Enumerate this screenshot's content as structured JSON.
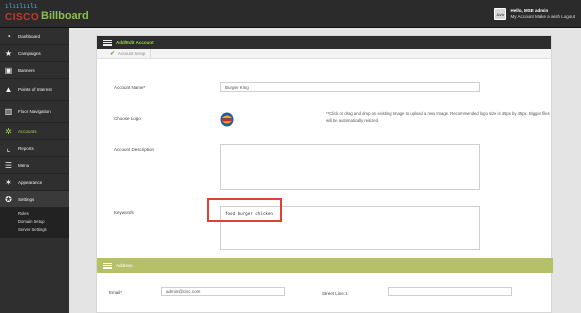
{
  "app": {
    "brand_bars": "ılıılıılı",
    "brand_name": "CISCO",
    "app_name": "Billboard"
  },
  "user": {
    "avatar_label": "Avtr",
    "greeting": "Hello, MSE admin",
    "links": "My Account  Make a wish  Logout"
  },
  "sidebar": {
    "items": [
      {
        "label": "Dashboard",
        "icon": "dashboard-icon",
        "glyph": "◔"
      },
      {
        "label": "Campaigns",
        "icon": "star-icon",
        "glyph": "★"
      },
      {
        "label": "Banners",
        "icon": "image-icon",
        "glyph": "▣"
      },
      {
        "label": "Points of Interest",
        "icon": "warning-icon",
        "glyph": "▲"
      },
      {
        "label": "Floor Navigation",
        "icon": "floor-icon",
        "glyph": "▥"
      },
      {
        "label": "Accounts",
        "icon": "gear-icon",
        "glyph": "✲"
      },
      {
        "label": "Reports",
        "icon": "chart-icon",
        "glyph": "⌞"
      },
      {
        "label": "Menu",
        "icon": "list-icon",
        "glyph": "☰"
      },
      {
        "label": "Appearance",
        "icon": "appearance-icon",
        "glyph": "✶"
      },
      {
        "label": "Settings",
        "icon": "settings-icon",
        "glyph": "✪"
      }
    ],
    "subitems": [
      "Roles",
      "Domain Setup",
      "Server Settings"
    ]
  },
  "panel": {
    "title": "Add/Edit Account",
    "tab_label": "Account Setup"
  },
  "form": {
    "account_name_label": "Account Name*",
    "account_name_value": "Burger King",
    "choose_logo_label": "Choose Logo",
    "logo_note": "**Click or drag and drop on existing Image to upload a new Image. Recommended logo size is 45px by 45px. Bigger files will be automatically resized.",
    "description_label": "Account Description",
    "description_value": "",
    "keywords_label": "Keywords",
    "keywords_value": "food burger chicken"
  },
  "address": {
    "title": "Address",
    "email_label": "Email*",
    "email_value": "admin@cisc.com",
    "street_label": "Street Line 1:",
    "street_value": ""
  },
  "colors": {
    "accent": "#9bd34a",
    "highlight": "#e04230",
    "address_bar": "#b5c068"
  }
}
